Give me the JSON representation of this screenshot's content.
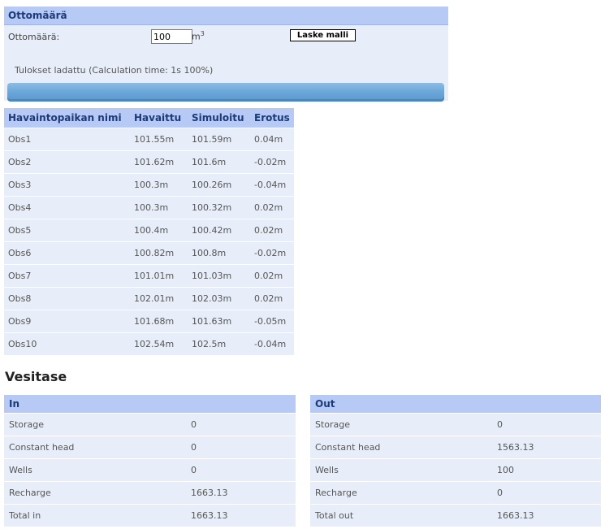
{
  "withdrawal": {
    "title": "Ottomäärä",
    "label": "Ottomäärä:",
    "value": "100",
    "unit": "m",
    "unit_sup": "3",
    "button": "Laske malli",
    "status": "Tulokset ladattu (Calculation time: 1s 100%)",
    "progress_percent": 100
  },
  "observations": {
    "headers": [
      "Havaintopaikan nimi",
      "Havaittu",
      "Simuloitu",
      "Erotus"
    ],
    "rows": [
      [
        "Obs1",
        "101.55m",
        "101.59m",
        "0.04m"
      ],
      [
        "Obs2",
        "101.62m",
        "101.6m",
        "-0.02m"
      ],
      [
        "Obs3",
        "100.3m",
        "100.26m",
        "-0.04m"
      ],
      [
        "Obs4",
        "100.3m",
        "100.32m",
        "0.02m"
      ],
      [
        "Obs5",
        "100.4m",
        "100.42m",
        "0.02m"
      ],
      [
        "Obs6",
        "100.82m",
        "100.8m",
        "-0.02m"
      ],
      [
        "Obs7",
        "101.01m",
        "101.03m",
        "0.02m"
      ],
      [
        "Obs8",
        "102.01m",
        "102.03m",
        "0.02m"
      ],
      [
        "Obs9",
        "101.68m",
        "101.63m",
        "-0.05m"
      ],
      [
        "Obs10",
        "102.54m",
        "102.5m",
        "-0.04m"
      ]
    ]
  },
  "water_balance": {
    "title": "Vesitase",
    "in": {
      "header": "In",
      "rows": [
        [
          "Storage",
          "0"
        ],
        [
          "Constant head",
          "0"
        ],
        [
          "Wells",
          "0"
        ],
        [
          "Recharge",
          "1663.13"
        ],
        [
          "Total in",
          "1663.13"
        ]
      ]
    },
    "out": {
      "header": "Out",
      "rows": [
        [
          "Storage",
          "0"
        ],
        [
          "Constant head",
          "1563.13"
        ],
        [
          "Wells",
          "100"
        ],
        [
          "Recharge",
          "0"
        ],
        [
          "Total out",
          "1663.13"
        ]
      ]
    }
  }
}
